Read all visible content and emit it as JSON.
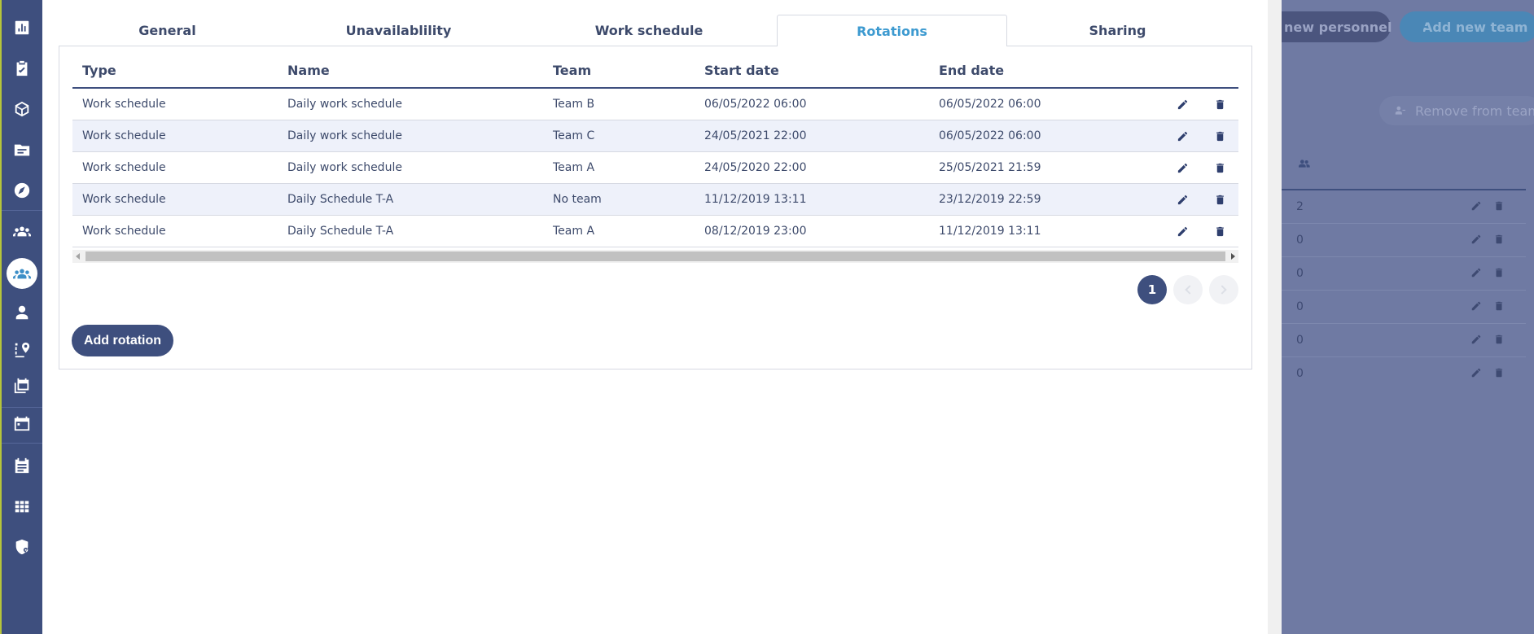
{
  "sidebar": {
    "icons": [
      "chart-icon",
      "clipboard-check-icon",
      "cube-icon",
      "folder-icon",
      "compass-icon",
      "group-icon",
      "team-icon",
      "person-icon",
      "route-icon",
      "calendar-stack-icon",
      "calendar-icon",
      "report-icon",
      "grid-icon",
      "shield-lock-icon"
    ],
    "active_icon": "team-icon"
  },
  "tabs": [
    {
      "label": "General"
    },
    {
      "label": "Unavailablility"
    },
    {
      "label": "Work schedule"
    },
    {
      "label": "Rotations"
    },
    {
      "label": "Sharing"
    }
  ],
  "active_tab": "Rotations",
  "table": {
    "headers": {
      "type": "Type",
      "name": "Name",
      "team": "Team",
      "start": "Start date",
      "end": "End date"
    },
    "rows": [
      {
        "type": "Work schedule",
        "name": "Daily work schedule",
        "team": "Team B",
        "start": "06/05/2022 06:00",
        "end": "06/05/2022 06:00"
      },
      {
        "type": "Work schedule",
        "name": "Daily work schedule",
        "team": "Team C",
        "start": "24/05/2021 22:00",
        "end": "06/05/2022 06:00"
      },
      {
        "type": "Work schedule",
        "name": "Daily work schedule",
        "team": "Team A",
        "start": "24/05/2020 22:00",
        "end": "25/05/2021 21:59"
      },
      {
        "type": "Work schedule",
        "name": "Daily Schedule T-A",
        "team": "No team",
        "start": "11/12/2019 13:11",
        "end": "23/12/2019 22:59"
      },
      {
        "type": "Work schedule",
        "name": "Daily Schedule T-A",
        "team": "Team A",
        "start": "08/12/2019 23:00",
        "end": "11/12/2019 13:11"
      }
    ]
  },
  "pagination": {
    "current": "1"
  },
  "add_rotation_label": "Add rotation",
  "background": {
    "add_personnel_label": "d new personnel",
    "add_team_label": "Add new team",
    "remove_label": "Remove from team",
    "counts": [
      "2",
      "0",
      "0",
      "0",
      "0",
      "0"
    ]
  },
  "colors": {
    "primary": "#3e4f7e",
    "accent": "#3d9ad0",
    "row_alt": "#eef1fa"
  }
}
